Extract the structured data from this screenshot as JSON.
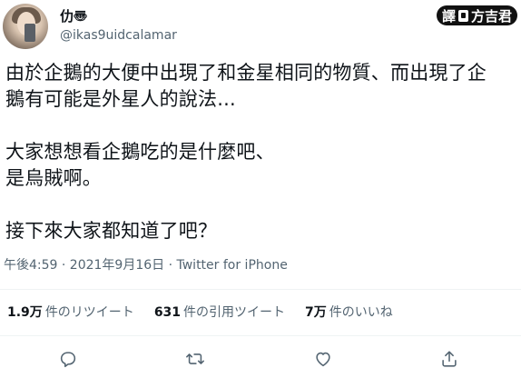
{
  "author": {
    "display_name": "仂〠",
    "handle": "@ikas9uidcalamar"
  },
  "watermark": {
    "icon": "translate-icon",
    "prefix": "譯",
    "text": "方吉君"
  },
  "tweet": {
    "text": "由於企鵝的大便中出現了和金星相同的物質、而出現了企\n鵝有可能是外星人的說法...\n\n大家想想看企鵝吃的是什麼吧、\n是烏賊啊。\n\n接下來大家都知道了吧？",
    "meta": "午後4:59 · 2021年9月16日 · Twitter for iPhone"
  },
  "stats": [
    {
      "num": "1.9万",
      "label": "件のリツイート"
    },
    {
      "num": "631",
      "label": "件の引用ツイート"
    },
    {
      "num": "7万",
      "label": "件のいいね"
    }
  ],
  "actions": [
    {
      "icon": "reply-icon"
    },
    {
      "icon": "retweet-icon"
    },
    {
      "icon": "like-icon"
    },
    {
      "icon": "share-icon"
    }
  ]
}
